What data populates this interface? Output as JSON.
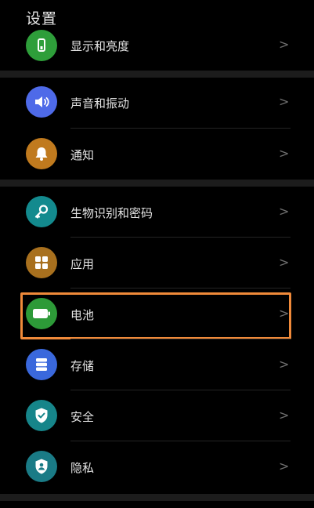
{
  "header": {
    "title": "设置"
  },
  "chevron": ">",
  "items": [
    {
      "key": "display",
      "label": "显示和亮度",
      "icon": "display-brightness-icon",
      "color": "#2e9e3a"
    },
    {
      "key": "sound",
      "label": "声音和振动",
      "icon": "speaker-icon",
      "color": "#4e6ae8"
    },
    {
      "key": "notifications",
      "label": "通知",
      "icon": "bell-icon",
      "color": "#c07a1e"
    },
    {
      "key": "biometrics",
      "label": "生物识别和密码",
      "icon": "key-icon",
      "color": "#138a8e"
    },
    {
      "key": "apps",
      "label": "应用",
      "icon": "apps-grid-icon",
      "color": "#a8701e"
    },
    {
      "key": "battery",
      "label": "电池",
      "icon": "battery-icon",
      "color": "#2d9a38"
    },
    {
      "key": "storage",
      "label": "存储",
      "icon": "storage-icon",
      "color": "#3a68dc"
    },
    {
      "key": "security",
      "label": "安全",
      "icon": "shield-check-icon",
      "color": "#16858a"
    },
    {
      "key": "privacy",
      "label": "隐私",
      "icon": "privacy-shield-icon",
      "color": "#1a7b86"
    }
  ],
  "highlight_color": "#f08a3a"
}
